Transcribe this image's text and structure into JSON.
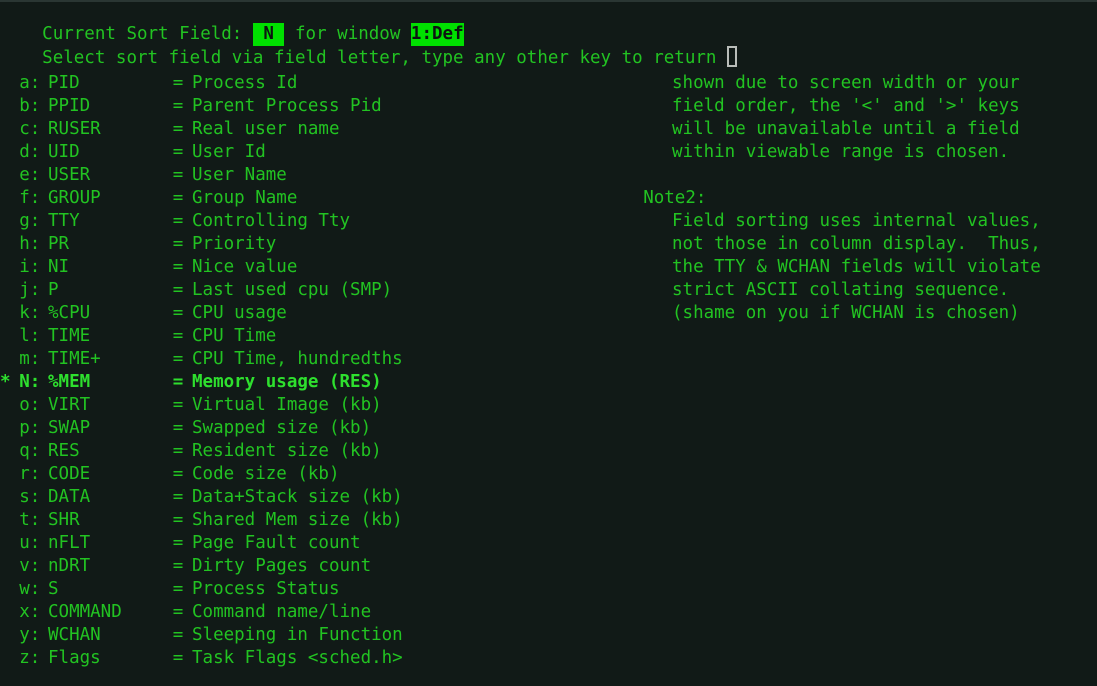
{
  "terminal": {
    "program": "top",
    "colors": {
      "background": "#111a17",
      "foreground": "#22c322",
      "bright_foreground": "#2ee02e",
      "highlight_background": "#00e000",
      "highlight_foreground": "#0d1411",
      "cursor_outline": "#b9bdb9"
    },
    "header": {
      "line1_prefix": "Current Sort Field: ",
      "sort_field_value": " N ",
      "line1_middle": " for window ",
      "window_value": "1:Def",
      "line2": "Select sort field via field letter, type any other key to return ",
      "cursor": "hollow-block"
    },
    "fields": [
      {
        "marker": " ",
        "letter": "a",
        "name": "PID",
        "eq": "=",
        "desc": "Process Id"
      },
      {
        "marker": " ",
        "letter": "b",
        "name": "PPID",
        "eq": "=",
        "desc": "Parent Process Pid"
      },
      {
        "marker": " ",
        "letter": "c",
        "name": "RUSER",
        "eq": "=",
        "desc": "Real user name"
      },
      {
        "marker": " ",
        "letter": "d",
        "name": "UID",
        "eq": "=",
        "desc": "User Id"
      },
      {
        "marker": " ",
        "letter": "e",
        "name": "USER",
        "eq": "=",
        "desc": "User Name"
      },
      {
        "marker": " ",
        "letter": "f",
        "name": "GROUP",
        "eq": "=",
        "desc": "Group Name"
      },
      {
        "marker": " ",
        "letter": "g",
        "name": "TTY",
        "eq": "=",
        "desc": "Controlling Tty"
      },
      {
        "marker": " ",
        "letter": "h",
        "name": "PR",
        "eq": "=",
        "desc": "Priority"
      },
      {
        "marker": " ",
        "letter": "i",
        "name": "NI",
        "eq": "=",
        "desc": "Nice value"
      },
      {
        "marker": " ",
        "letter": "j",
        "name": "P",
        "eq": "=",
        "desc": "Last used cpu (SMP)"
      },
      {
        "marker": " ",
        "letter": "k",
        "name": "%CPU",
        "eq": "=",
        "desc": "CPU usage"
      },
      {
        "marker": " ",
        "letter": "l",
        "name": "TIME",
        "eq": "=",
        "desc": "CPU Time"
      },
      {
        "marker": " ",
        "letter": "m",
        "name": "TIME+",
        "eq": "=",
        "desc": "CPU Time, hundredths"
      },
      {
        "marker": "*",
        "letter": "N",
        "name": "%MEM",
        "eq": "=",
        "desc": "Memory usage (RES)",
        "selected": true
      },
      {
        "marker": " ",
        "letter": "o",
        "name": "VIRT",
        "eq": "=",
        "desc": "Virtual Image (kb)"
      },
      {
        "marker": " ",
        "letter": "p",
        "name": "SWAP",
        "eq": "=",
        "desc": "Swapped size (kb)"
      },
      {
        "marker": " ",
        "letter": "q",
        "name": "RES",
        "eq": "=",
        "desc": "Resident size (kb)"
      },
      {
        "marker": " ",
        "letter": "r",
        "name": "CODE",
        "eq": "=",
        "desc": "Code size (kb)"
      },
      {
        "marker": " ",
        "letter": "s",
        "name": "DATA",
        "eq": "=",
        "desc": "Data+Stack size (kb)"
      },
      {
        "marker": " ",
        "letter": "t",
        "name": "SHR",
        "eq": "=",
        "desc": "Shared Mem size (kb)"
      },
      {
        "marker": " ",
        "letter": "u",
        "name": "nFLT",
        "eq": "=",
        "desc": "Page Fault count"
      },
      {
        "marker": " ",
        "letter": "v",
        "name": "nDRT",
        "eq": "=",
        "desc": "Dirty Pages count"
      },
      {
        "marker": " ",
        "letter": "w",
        "name": "S",
        "eq": "=",
        "desc": "Process Status"
      },
      {
        "marker": " ",
        "letter": "x",
        "name": "COMMAND",
        "eq": "=",
        "desc": "Command name/line"
      },
      {
        "marker": " ",
        "letter": "y",
        "name": "WCHAN",
        "eq": "=",
        "desc": "Sleeping in Function"
      },
      {
        "marker": " ",
        "letter": "z",
        "name": "Flags",
        "eq": "=",
        "desc": "Task Flags <sched.h>"
      }
    ],
    "notes_right": {
      "note1_lines": [
        "shown due to screen width or your",
        "field order, the '<' and '>' keys",
        "will be unavailable until a field",
        "within viewable range is chosen."
      ],
      "note2_title": "Note2:",
      "note2_lines": [
        "Field sorting uses internal values,",
        "not those in column display.  Thus,",
        "the TTY & WCHAN fields will violate",
        "strict ASCII collating sequence.",
        "(shame on you if WCHAN is chosen)"
      ]
    }
  }
}
